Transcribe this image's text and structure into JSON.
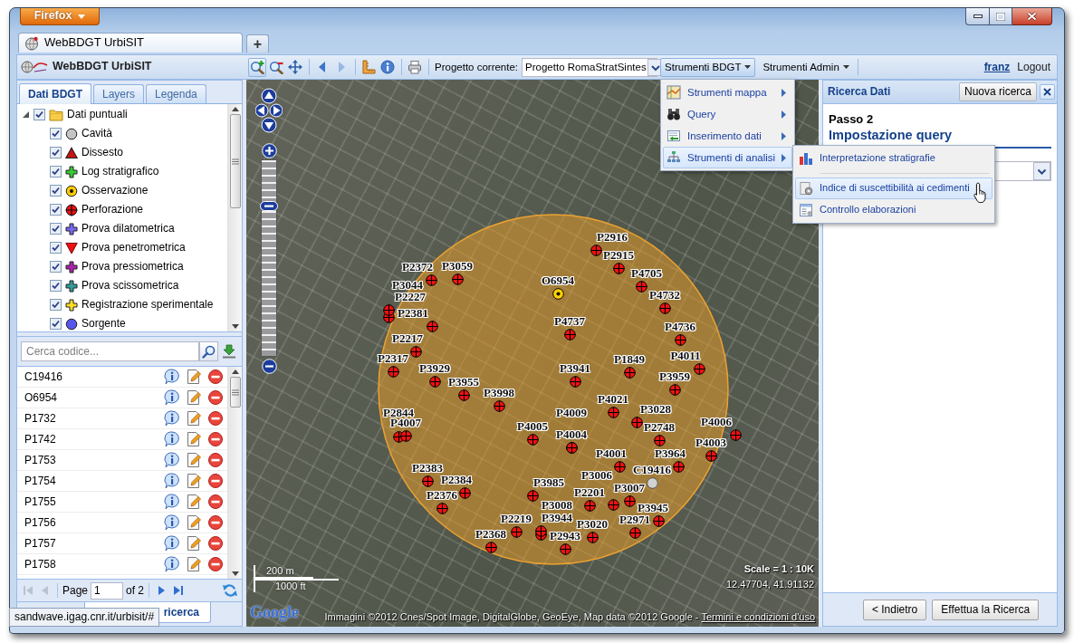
{
  "browser": {
    "menu_button": "Firefox",
    "tabs": [
      {
        "title": "WebBDGT UrbiSIT",
        "selected": true
      }
    ],
    "new_tab": "+",
    "status_url": "sandwave.igag.cnr.it/urbisit/#"
  },
  "header": {
    "title": "WebBDGT UrbiSIT",
    "tool_groups": [
      [
        {
          "kind": "zoom-in",
          "selected": true,
          "disabled": false
        },
        {
          "kind": "zoom-out",
          "selected": false,
          "disabled": false
        },
        {
          "kind": "pan",
          "selected": false,
          "disabled": false
        }
      ],
      [
        {
          "kind": "back",
          "selected": false,
          "disabled": false
        },
        {
          "kind": "forward",
          "selected": false,
          "disabled": true
        }
      ],
      [
        {
          "kind": "measure",
          "selected": false,
          "disabled": false
        },
        {
          "kind": "info",
          "selected": false,
          "disabled": false
        }
      ],
      [
        {
          "kind": "print",
          "selected": false,
          "disabled": false
        }
      ]
    ],
    "project": {
      "label": "Progetto corrente:",
      "value": "Progetto RomaStratSintes"
    },
    "menus": [
      {
        "label": "Strumenti BDGT",
        "selected": true
      },
      {
        "label": "Strumenti Admin",
        "selected": false
      }
    ],
    "user": "franz",
    "logout": "Logout"
  },
  "tools_menu": {
    "items": [
      {
        "label": "Strumenti mappa",
        "kind": "map",
        "selected": false
      },
      {
        "label": "Query",
        "kind": "binoculars",
        "selected": false
      },
      {
        "label": "Inserimento dati",
        "kind": "form",
        "selected": false
      },
      {
        "label": "Strumenti di analisi",
        "kind": "hierarchy",
        "selected": true
      }
    ],
    "submenu": [
      {
        "label": "Interpretazione stratigrafie",
        "kind": "chart",
        "selected": false
      },
      {
        "kind": "separator"
      },
      {
        "label": "Indice di suscettibilità ai cedimenti",
        "kind": "gear-sheet",
        "selected": true
      },
      {
        "label": "Controllo elaborazioni",
        "kind": "sheet",
        "selected": false
      }
    ]
  },
  "left_panel": {
    "tabs": [
      {
        "label": "Dati BDGT",
        "selected": true
      },
      {
        "label": "Layers",
        "selected": false
      },
      {
        "label": "Legenda",
        "selected": false
      }
    ],
    "tree": [
      {
        "label": "Dati puntuali",
        "kind": "folder",
        "checked": true,
        "expanded": true,
        "children": [
          {
            "label": "Cavità",
            "kind": "circle",
            "color": "#c4c4c4",
            "checked": true
          },
          {
            "label": "Dissesto",
            "kind": "triangle",
            "color": "#cc1111",
            "checked": true
          },
          {
            "label": "Log stratigrafico",
            "kind": "cross",
            "color": "#33cc33",
            "checked": true
          },
          {
            "label": "Osservazione",
            "kind": "target",
            "color": "#ffcc00",
            "checked": true
          },
          {
            "label": "Perforazione",
            "kind": "crosshair",
            "color": "#ee1111",
            "checked": true
          },
          {
            "label": "Prova dilatometrica",
            "kind": "cross",
            "color": "#7766ee",
            "checked": true
          },
          {
            "label": "Prova penetrometrica",
            "kind": "triangle-down",
            "color": "#ee1111",
            "checked": true
          },
          {
            "label": "Prova pressiometrica",
            "kind": "cross",
            "color": "#aa22aa",
            "checked": true
          },
          {
            "label": "Prova scissometrica",
            "kind": "cross",
            "color": "#339999",
            "checked": true
          },
          {
            "label": "Registrazione sperimentale",
            "kind": "cross",
            "color": "#ffdd22",
            "checked": true
          },
          {
            "label": "Sorgente",
            "kind": "circle",
            "color": "#5555ee",
            "checked": true
          }
        ]
      }
    ],
    "search": {
      "placeholder": "Cerca codice..."
    },
    "records": [
      "C19416",
      "O6954",
      "P1732",
      "P1742",
      "P1753",
      "P1754",
      "P1755",
      "P1756",
      "P1757",
      "P1758"
    ],
    "pager": {
      "back": [
        {
          "kind": "first",
          "disabled": true
        },
        {
          "kind": "prev",
          "disabled": true
        }
      ],
      "label": "Page",
      "page": "1",
      "total": "of 2",
      "forward": [
        {
          "kind": "next",
          "disabled": false
        },
        {
          "kind": "last",
          "disabled": false
        }
      ]
    },
    "bottom_tabs": [
      {
        "label": "ricerca",
        "selected": true
      }
    ]
  },
  "map": {
    "zoom": {
      "level": 0.78
    },
    "points": [
      {
        "label": "P2916",
        "kind": "perforazione"
      },
      {
        "label": "P2915",
        "kind": "perforazione"
      },
      {
        "label": "P2372",
        "kind": "perforazione"
      },
      {
        "label": "P3059",
        "kind": "perforazione"
      },
      {
        "label": "P4705",
        "kind": "perforazione"
      },
      {
        "label": "O6954",
        "kind": "osservazione"
      },
      {
        "label": "P3044",
        "kind": "perforazione"
      },
      {
        "label": "P2227",
        "kind": "perforazione"
      },
      {
        "label": "P4732",
        "kind": "perforazione"
      },
      {
        "label": "P2381",
        "kind": "perforazione"
      },
      {
        "label": "P4737",
        "kind": "perforazione"
      },
      {
        "label": "P4736",
        "kind": "perforazione"
      },
      {
        "label": "P2217",
        "kind": "perforazione"
      },
      {
        "label": "P2317",
        "kind": "perforazione"
      },
      {
        "label": "P1849",
        "kind": "perforazione"
      },
      {
        "label": "P4011",
        "kind": "perforazione"
      },
      {
        "label": "P3929",
        "kind": "perforazione"
      },
      {
        "label": "P3941",
        "kind": "perforazione"
      },
      {
        "label": "P3959",
        "kind": "perforazione"
      },
      {
        "label": "P3955",
        "kind": "perforazione"
      },
      {
        "label": "P3998",
        "kind": "perforazione"
      },
      {
        "label": "P4021",
        "kind": "perforazione"
      },
      {
        "label": "P2844",
        "kind": "perforazione"
      },
      {
        "label": "P4009",
        "kind": "perforazione"
      },
      {
        "label": "P3028",
        "kind": "perforazione"
      },
      {
        "label": "P4007",
        "kind": "perforazione"
      },
      {
        "label": "P4005",
        "kind": "perforazione"
      },
      {
        "label": "P2748",
        "kind": "perforazione"
      },
      {
        "label": "P4006",
        "kind": "perforazione"
      },
      {
        "label": "P4004",
        "kind": "perforazione"
      },
      {
        "label": "P4003",
        "kind": "perforazione"
      },
      {
        "label": "P4001",
        "kind": "perforazione"
      },
      {
        "label": "P3964",
        "kind": "perforazione"
      },
      {
        "label": "P2383",
        "kind": "perforazione"
      },
      {
        "label": "C19416",
        "kind": "cavita"
      },
      {
        "label": "P2384",
        "kind": "perforazione"
      },
      {
        "label": "P3985",
        "kind": "perforazione"
      },
      {
        "label": "P3006",
        "kind": "perforazione"
      },
      {
        "label": "P2376",
        "kind": "perforazione"
      },
      {
        "label": "P2201",
        "kind": "perforazione"
      },
      {
        "label": "P3007",
        "kind": "perforazione"
      },
      {
        "label": "P3008",
        "kind": "perforazione"
      },
      {
        "label": "P3945",
        "kind": "perforazione"
      },
      {
        "label": "P2219",
        "kind": "perforazione"
      },
      {
        "label": "P3944",
        "kind": "perforazione"
      },
      {
        "label": "P3020",
        "kind": "perforazione"
      },
      {
        "label": "P2971",
        "kind": "perforazione"
      },
      {
        "label": "P2368",
        "kind": "perforazione"
      },
      {
        "label": "P2943",
        "kind": "perforazione"
      }
    ],
    "scale_bar": {
      "metric": "200 m",
      "imperial": "1000 ft"
    },
    "scale": "Scale = 1 : 10K",
    "coordinates": "12.47704, 41.91132",
    "logo": "Google",
    "attribution": {
      "text": "Immagini ©2012 Cnes/Spot Image, DigitalGlobe, GeoEye, Map data ©2012 Google -",
      "link": "Termini e condizioni d'uso"
    }
  },
  "search_panel": {
    "title": "Ricerca Dati",
    "new_search": "Nuova ricerca",
    "step": "Passo 2",
    "heading": "Impostazione query",
    "back": "< Indietro",
    "submit": "Effettua la Ricerca"
  }
}
